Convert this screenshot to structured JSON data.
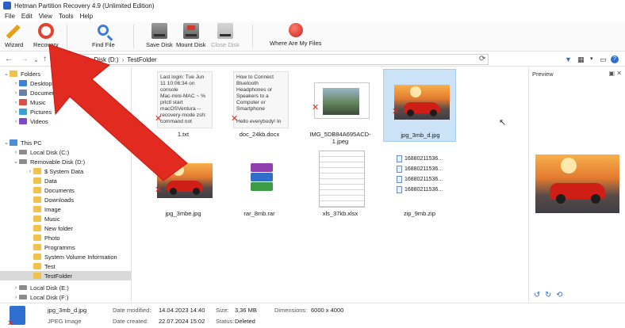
{
  "window": {
    "title": "Hetman Partition Recovery 4.9 (Unlimited Edition)"
  },
  "menu": [
    "File",
    "Edit",
    "View",
    "Tools",
    "Help"
  ],
  "toolbar": {
    "wizard": "Wizard",
    "recovery": "Recovery",
    "find_file": "Find File",
    "save_disk": "Save Disk",
    "mount_disk": "Mount Disk",
    "close_disk": "Close Disk",
    "where_files": "Where Are My Files"
  },
  "address": {
    "drive": "movable Disk (D:)",
    "folder": "TestFolder"
  },
  "tree": [
    {
      "label": "Folders",
      "icon": "folder-icon"
    },
    {
      "label": "Desktop",
      "icon": "desktop-icon"
    },
    {
      "label": "Documents",
      "icon": "documents-icon"
    },
    {
      "label": "Music",
      "icon": "music-icon"
    },
    {
      "label": "Pictures",
      "icon": "pictures-icon"
    },
    {
      "label": "Videos",
      "icon": "videos-icon"
    },
    {
      "label": "This PC",
      "icon": "pc-icon"
    },
    {
      "label": "Local Disk (C:)",
      "icon": "drive-icon"
    },
    {
      "label": "Removable Disk (D:)",
      "icon": "drive-icon"
    },
    {
      "label": "$ System Data",
      "icon": "folder-icon"
    },
    {
      "label": "Data",
      "icon": "folder-icon"
    },
    {
      "label": "Documents",
      "icon": "folder-icon"
    },
    {
      "label": "Downloads",
      "icon": "folder-icon"
    },
    {
      "label": "Image",
      "icon": "folder-icon"
    },
    {
      "label": "Music",
      "icon": "folder-icon"
    },
    {
      "label": "New folder",
      "icon": "folder-icon"
    },
    {
      "label": "Photo",
      "icon": "folder-icon"
    },
    {
      "label": "Programms",
      "icon": "folder-icon"
    },
    {
      "label": "System Volume Information",
      "icon": "folder-icon"
    },
    {
      "label": "Test",
      "icon": "folder-icon"
    },
    {
      "label": "TestFolder",
      "icon": "folder-icon"
    },
    {
      "label": "Local Disk (E:)",
      "icon": "drive-icon"
    },
    {
      "label": "Local Disk (F:)",
      "icon": "drive-icon"
    }
  ],
  "files": [
    {
      "name": "1.txt",
      "preview": "Last login: Tue Jun 11 10:06:34 on console\nMac-mini-MAC ~ % prlctl start macOSVentura --recovery-mode zsh: command not"
    },
    {
      "name": "doc_24kb.docx",
      "preview": "How to Connect Bluetooth Headphones or Speakers to a Computer or Smartphone\n\nHello everybody! In"
    },
    {
      "name": "IMG_5DB84A695ACD-1.jpeg"
    },
    {
      "name": "jpg_3mb_d.jpg"
    },
    {
      "name": "jpg_3mbe.jpg"
    },
    {
      "name": "rar_8mb.rar"
    },
    {
      "name": "xls_37kb.xlsx"
    },
    {
      "name": "zip_9mb.zip",
      "items": [
        "16880211536...",
        "16880211536...",
        "16880211536...",
        "16880211536..."
      ]
    }
  ],
  "preview": {
    "title": "Preview"
  },
  "status": {
    "filename": "jpg_3mb_d.jpg",
    "filetype": "JPEG Image",
    "modified_label": "Date modified:",
    "modified_value": "14.04.2023 14:40",
    "created_label": "Date created:",
    "created_value": "22.07.2024 15:02",
    "size_label": "Size:",
    "size_value": "3,36 MB",
    "status_label": "Status:",
    "status_value": "Deleted",
    "dims_label": "Dimensions:",
    "dims_value": "6000 x 4000"
  },
  "colors": {
    "accent": "#2e6fd0",
    "selection": "#cce3f7",
    "deleted_mark": "#d5322a",
    "arrow": "#e12a20"
  }
}
